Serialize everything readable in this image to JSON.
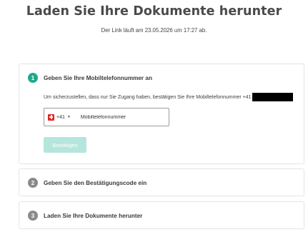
{
  "page": {
    "title": "Laden Sie Ihre Dokumente herunter",
    "subtitle": "Der Link läuft am 23.05.2026 um 17:27 ab."
  },
  "steps": [
    {
      "number": "1",
      "title": "Geben Sie Ihre Mobiltelefonnummer an",
      "description": "Um sicherzustellen, dass nur Sie Zugang haben, bestätigen Sie Ihre Mobiltelefonnummer +41",
      "phone": {
        "country_flag": "switzerland-flag-icon",
        "dial_code": "+41",
        "placeholder": "Mobiltelefonnummer",
        "value": ""
      },
      "button_label": "Bestätigen"
    },
    {
      "number": "2",
      "title": "Geben Sie den Bestätigungscode ein"
    },
    {
      "number": "3",
      "title": "Laden Sie Ihre Dokumente herunter"
    }
  ],
  "colors": {
    "accent": "#1fa98f",
    "inactive_step": "#8a8a8a",
    "button_disabled": "#b5e5dc"
  }
}
